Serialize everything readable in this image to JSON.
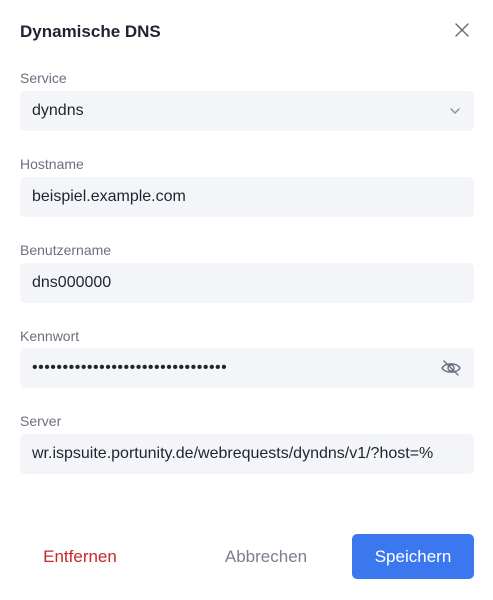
{
  "dialog": {
    "title": "Dynamische DNS",
    "close_icon": "close-icon"
  },
  "fields": {
    "service": {
      "label": "Service",
      "value": "dyndns",
      "icon": "chevron-down-icon"
    },
    "hostname": {
      "label": "Hostname",
      "value": "beispiel.example.com"
    },
    "username": {
      "label": "Benutzername",
      "value": "dns000000"
    },
    "password": {
      "label": "Kennwort",
      "value": "••••••••••••••••••••••••••••••••",
      "icon": "eye-off-icon"
    },
    "server": {
      "label": "Server",
      "value": "wr.ispsuite.portunity.de/webrequests/dyndns/v1/?host=%"
    }
  },
  "buttons": {
    "remove": "Entfernen",
    "cancel": "Abbrechen",
    "save": "Speichern"
  },
  "colors": {
    "primary": "#3b78f0",
    "danger": "#c62828",
    "field_bg": "#f4f5f8"
  }
}
